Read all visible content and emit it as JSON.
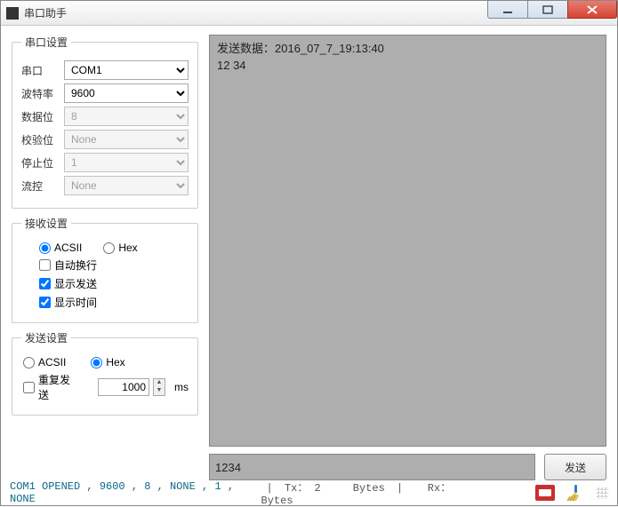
{
  "app": {
    "title": "串口助手"
  },
  "serial": {
    "legend": "串口设置",
    "port_label": "串口",
    "port_value": "COM1",
    "baud_label": "波特率",
    "baud_value": "9600",
    "data_label": "数据位",
    "data_value": "8",
    "parity_label": "校验位",
    "parity_value": "None",
    "stop_label": "停止位",
    "stop_value": "1",
    "flow_label": "流控",
    "flow_value": "None"
  },
  "recv": {
    "legend": "接收设置",
    "ascii": "ACSII",
    "hex": "Hex",
    "autowrap": "自动换行",
    "showsend": "显示发送",
    "showtime": "显示时间",
    "ascii_checked": true,
    "hex_checked": false,
    "autowrap_checked": false,
    "showsend_checked": true,
    "showtime_checked": true
  },
  "send": {
    "legend": "发送设置",
    "ascii": "ACSII",
    "hex": "Hex",
    "hex_checked": true,
    "repeat": "重复发送",
    "repeat_checked": false,
    "interval": "1000",
    "unit": "ms"
  },
  "rx": {
    "line1": "发送数据：2016_07_7_19:13:40",
    "line2": "12 34"
  },
  "tx": {
    "value": "1234",
    "send_label": "发送"
  },
  "status": {
    "link": "COM1 OPENED , 9600 , 8 , NONE , 1 , NONE",
    "tx_label": "Tx：",
    "tx_val": "2",
    "bytes": "Bytes",
    "rx_label": "Rx：",
    "rx_val": ""
  }
}
